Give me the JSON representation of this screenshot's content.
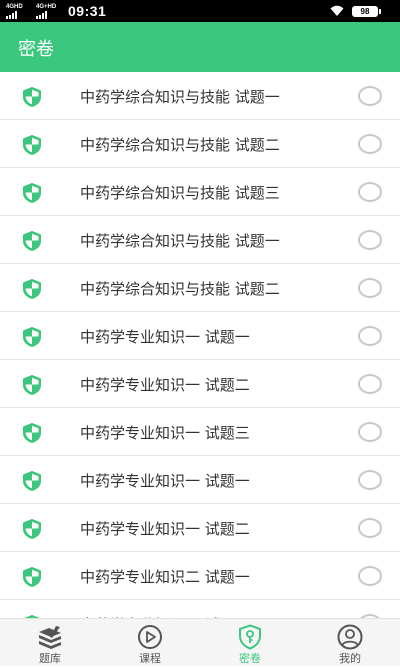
{
  "status_bar": {
    "signal1_label": "4GHD",
    "signal2_label": "4G+HD",
    "time": "09:31",
    "battery": "98"
  },
  "header": {
    "title": "密卷"
  },
  "colors": {
    "accent": "#3cc77f",
    "radio_border": "#c6c9cc",
    "text": "#333333"
  },
  "papers": [
    {
      "title": "中药学综合知识与技能 试题一"
    },
    {
      "title": "中药学综合知识与技能 试题二"
    },
    {
      "title": "中药学综合知识与技能 试题三"
    },
    {
      "title": "中药学综合知识与技能 试题一"
    },
    {
      "title": "中药学综合知识与技能 试题二"
    },
    {
      "title": "中药学专业知识一 试题一"
    },
    {
      "title": "中药学专业知识一 试题二"
    },
    {
      "title": "中药学专业知识一 试题三"
    },
    {
      "title": "中药学专业知识一 试题一"
    },
    {
      "title": "中药学专业知识一 试题二"
    },
    {
      "title": "中药学专业知识二 试题一"
    },
    {
      "title": "中药学专业知识二 试题一"
    }
  ],
  "tabs": [
    {
      "label": "题库",
      "icon": "books-icon"
    },
    {
      "label": "课程",
      "icon": "play-circle-icon"
    },
    {
      "label": "密卷",
      "icon": "shield-key-icon",
      "active": true
    },
    {
      "label": "我的",
      "icon": "user-circle-icon"
    }
  ]
}
